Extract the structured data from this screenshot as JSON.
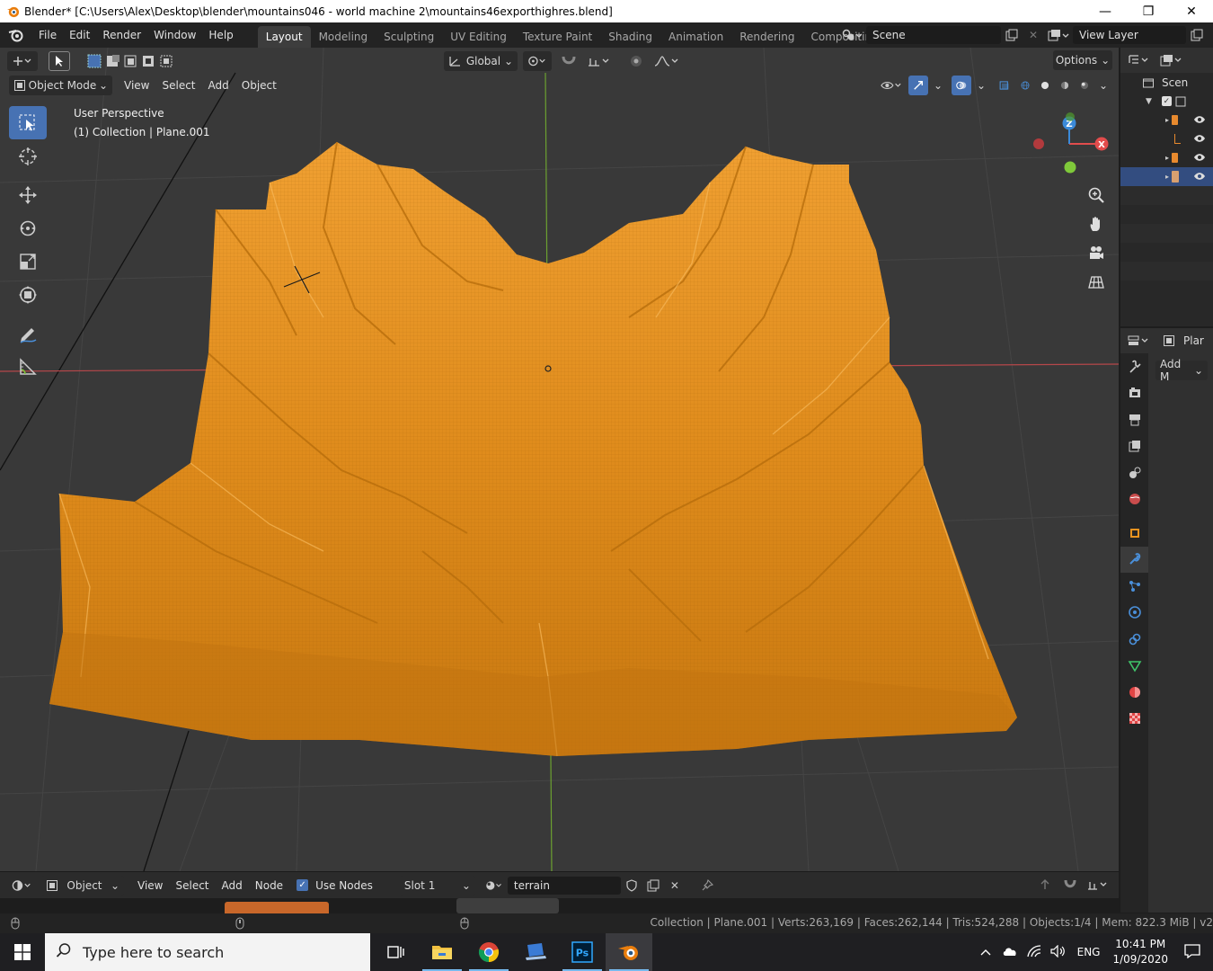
{
  "window": {
    "title": "Blender* [C:\\Users\\Alex\\Desktop\\blender\\mountains046 - world machine 2\\mountains46exporthighres.blend]",
    "minimize": "—",
    "maximize": "❐",
    "close": "✕"
  },
  "menu": {
    "file": "File",
    "edit": "Edit",
    "render": "Render",
    "window": "Window",
    "help": "Help"
  },
  "workspaces": [
    {
      "label": "Layout",
      "active": true
    },
    {
      "label": "Modeling",
      "active": false
    },
    {
      "label": "Sculpting",
      "active": false
    },
    {
      "label": "UV Editing",
      "active": false
    },
    {
      "label": "Texture Paint",
      "active": false
    },
    {
      "label": "Shading",
      "active": false
    },
    {
      "label": "Animation",
      "active": false
    },
    {
      "label": "Rendering",
      "active": false
    },
    {
      "label": "Compositing",
      "active": false
    }
  ],
  "scene": {
    "name": "Scene",
    "view_layer": "View Layer"
  },
  "viewport": {
    "transform_orientation": "Global",
    "options_label": "Options",
    "mode": "Object Mode",
    "menu_view": "View",
    "menu_select": "Select",
    "menu_add": "Add",
    "menu_object": "Object",
    "perspective_label": "User Perspective",
    "collection_label": "(1) Collection | Plane.001",
    "axis_x": "X",
    "axis_y": "Y",
    "axis_z": "Z",
    "mesh_color": "#e8931f"
  },
  "node_editor": {
    "object_type": "Object",
    "menu_view": "View",
    "menu_select": "Select",
    "menu_add": "Add",
    "menu_node": "Node",
    "use_nodes_label": "Use Nodes",
    "use_nodes": true,
    "slot": "Slot 1",
    "material": "terrain"
  },
  "outliner": {
    "scene_label": "Scen"
  },
  "properties": {
    "object_label": "Plar",
    "add_modifier": "Add M"
  },
  "statusbar": {
    "stats": "Collection | Plane.001 | Verts:263,169 | Faces:262,144 | Tris:524,288 | Objects:1/4 | Mem: 822.3 MiB | v2"
  },
  "taskbar": {
    "search_placeholder": "Type here to search",
    "language": "ENG",
    "time": "10:41 PM",
    "date": "1/09/2020"
  },
  "colors": {
    "accent": "#4772b3",
    "mesh": "#e8931f",
    "axis_x": "#e24c4c",
    "axis_y": "#7fc93a",
    "axis_z": "#3b8ad9"
  }
}
